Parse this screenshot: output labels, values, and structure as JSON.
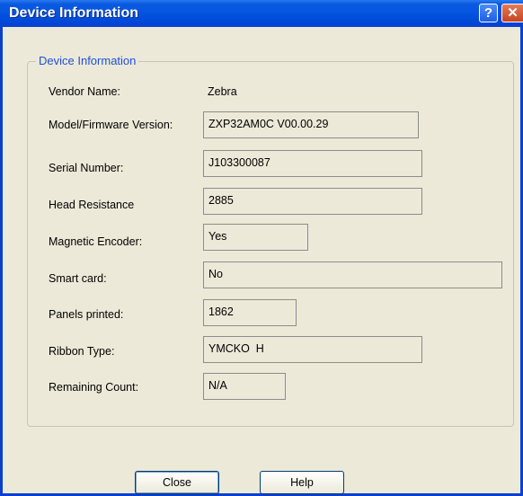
{
  "window": {
    "title": "Device Information",
    "help_glyph": "?",
    "close_glyph": "✕"
  },
  "group": {
    "title": "Device Information",
    "rows": [
      {
        "label": "Vendor Name:",
        "value": "Zebra"
      },
      {
        "label": "Model/Firmware Version:",
        "value": "ZXP32AM0C V00.00.29"
      },
      {
        "label": "Serial Number:",
        "value": "J103300087"
      },
      {
        "label": "Head Resistance",
        "value": "2885"
      },
      {
        "label": "Magnetic Encoder:",
        "value": "Yes"
      },
      {
        "label": "Smart card:",
        "value": "No"
      },
      {
        "label": "Panels printed:",
        "value": "1862"
      },
      {
        "label": "Ribbon Type:",
        "value": "YMCKO  H"
      },
      {
        "label": "Remaining Count:",
        "value": "N/A"
      }
    ]
  },
  "buttons": {
    "close": "Close",
    "help": "Help"
  },
  "colors": {
    "title_bar": "#0454e0",
    "group_title": "#1f4fd6",
    "dialog_bg": "#ece9d8"
  }
}
